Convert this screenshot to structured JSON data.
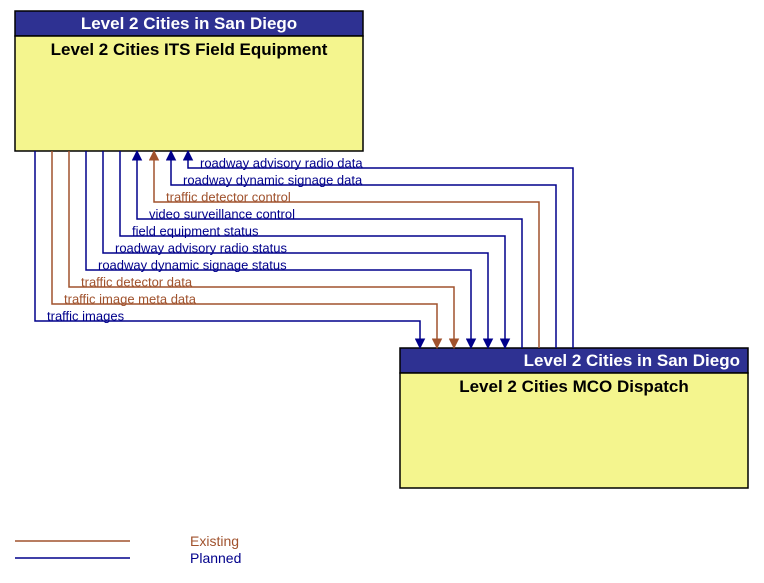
{
  "boxes": {
    "source": {
      "header": "Level 2 Cities in San Diego",
      "body": "Level 2 Cities ITS Field Equipment"
    },
    "target": {
      "header": "Level 2 Cities in San Diego",
      "body": "Level 2 Cities MCO Dispatch"
    }
  },
  "flows": [
    {
      "label": "roadway advisory radio data",
      "status": "planned",
      "direction": "to_source"
    },
    {
      "label": "roadway dynamic signage data",
      "status": "planned",
      "direction": "to_source"
    },
    {
      "label": "traffic detector control",
      "status": "existing",
      "direction": "to_source"
    },
    {
      "label": "video surveillance control",
      "status": "planned",
      "direction": "to_source"
    },
    {
      "label": "field equipment status",
      "status": "planned",
      "direction": "to_target"
    },
    {
      "label": "roadway advisory radio status",
      "status": "planned",
      "direction": "to_target"
    },
    {
      "label": "roadway dynamic signage status",
      "status": "planned",
      "direction": "to_target"
    },
    {
      "label": "traffic detector data",
      "status": "existing",
      "direction": "to_target"
    },
    {
      "label": "traffic image meta data",
      "status": "existing",
      "direction": "to_target"
    },
    {
      "label": "traffic images",
      "status": "planned",
      "direction": "to_target"
    }
  ],
  "legend": {
    "existing": "Existing",
    "planned": "Planned"
  },
  "colors": {
    "existing": "#a0522d",
    "planned": "#00008b",
    "box_header": "#2e3192",
    "box_body": "#f4f58e"
  }
}
